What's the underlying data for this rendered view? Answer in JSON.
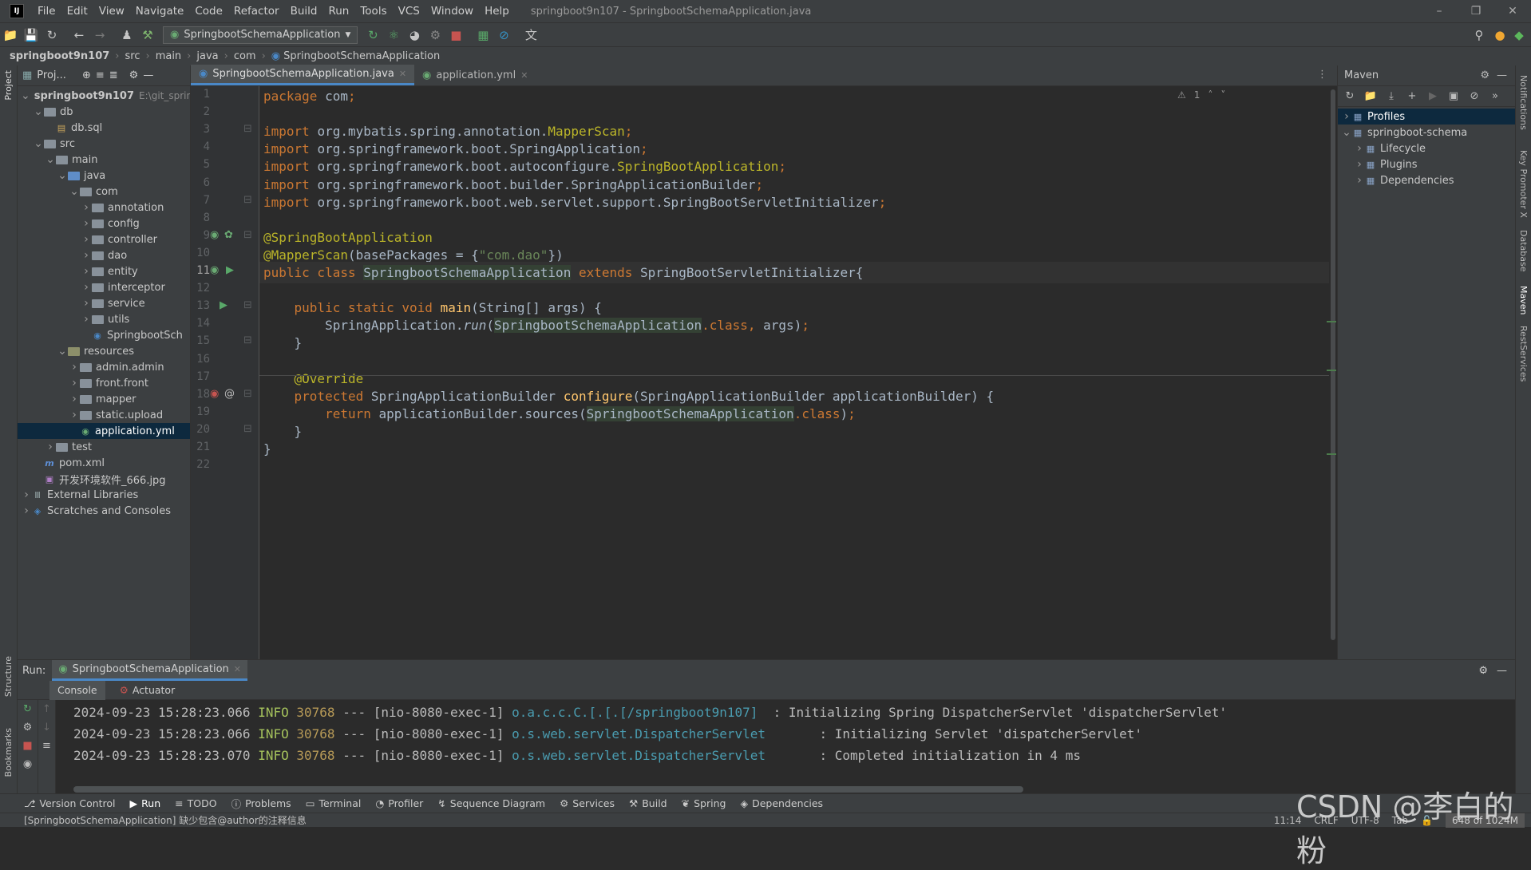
{
  "window": {
    "title": "springboot9n107 - SpringbootSchemaApplication.java"
  },
  "menu": [
    "File",
    "Edit",
    "View",
    "Navigate",
    "Code",
    "Refactor",
    "Build",
    "Run",
    "Tools",
    "VCS",
    "Window",
    "Help"
  ],
  "toolbar": {
    "run_config": "SpringbootSchemaApplication"
  },
  "breadcrumb": [
    "springboot9n107",
    "src",
    "main",
    "java",
    "com",
    "SpringbootSchemaApplication"
  ],
  "left_strip": {
    "project": "Project",
    "structure": "Structure",
    "bookmarks": "Bookmarks"
  },
  "project_panel": {
    "header": "Proj...",
    "items": [
      {
        "label": "springboot9n107",
        "extra": "E:\\git_sprin",
        "depth": 0,
        "kind": "module",
        "open": true
      },
      {
        "label": "db",
        "depth": 1,
        "kind": "folder",
        "open": true
      },
      {
        "label": "db.sql",
        "depth": 2,
        "kind": "sql"
      },
      {
        "label": "src",
        "depth": 1,
        "kind": "folder",
        "open": true
      },
      {
        "label": "main",
        "depth": 2,
        "kind": "folder",
        "open": true
      },
      {
        "label": "java",
        "depth": 3,
        "kind": "src",
        "open": true
      },
      {
        "label": "com",
        "depth": 4,
        "kind": "folder",
        "open": true
      },
      {
        "label": "annotation",
        "depth": 5,
        "kind": "folder",
        "open": false
      },
      {
        "label": "config",
        "depth": 5,
        "kind": "folder",
        "open": false
      },
      {
        "label": "controller",
        "depth": 5,
        "kind": "folder",
        "open": false
      },
      {
        "label": "dao",
        "depth": 5,
        "kind": "folder",
        "open": false
      },
      {
        "label": "entity",
        "depth": 5,
        "kind": "folder",
        "open": false
      },
      {
        "label": "interceptor",
        "depth": 5,
        "kind": "folder",
        "open": false
      },
      {
        "label": "service",
        "depth": 5,
        "kind": "folder",
        "open": false
      },
      {
        "label": "utils",
        "depth": 5,
        "kind": "folder",
        "open": false
      },
      {
        "label": "SpringbootSch",
        "depth": 5,
        "kind": "class"
      },
      {
        "label": "resources",
        "depth": 3,
        "kind": "res",
        "open": true
      },
      {
        "label": "admin.admin",
        "depth": 4,
        "kind": "folder",
        "open": false
      },
      {
        "label": "front.front",
        "depth": 4,
        "kind": "folder",
        "open": false
      },
      {
        "label": "mapper",
        "depth": 4,
        "kind": "folder",
        "open": false
      },
      {
        "label": "static.upload",
        "depth": 4,
        "kind": "folder",
        "open": false
      },
      {
        "label": "application.yml",
        "depth": 4,
        "kind": "yml",
        "selected": true
      },
      {
        "label": "test",
        "depth": 2,
        "kind": "folder",
        "open": false
      },
      {
        "label": "pom.xml",
        "depth": 1,
        "kind": "maven"
      },
      {
        "label": "开发环境软件_666.jpg",
        "depth": 1,
        "kind": "image"
      },
      {
        "label": "External Libraries",
        "depth": 0,
        "kind": "libs",
        "open": false
      },
      {
        "label": "Scratches and Consoles",
        "depth": 0,
        "kind": "scratch",
        "open": false
      }
    ]
  },
  "editor_tabs": [
    {
      "label": "SpringbootSchemaApplication.java",
      "active": true
    },
    {
      "label": "application.yml",
      "active": false
    }
  ],
  "inspection_count": "1",
  "code_lines": [
    [
      [
        "kw",
        "package "
      ],
      [
        "",
        "com"
      ],
      [
        "kw",
        ";"
      ]
    ],
    [],
    [
      [
        "kw",
        "import "
      ],
      [
        "",
        "org.mybatis.spring.annotation."
      ],
      [
        "an",
        "MapperScan"
      ],
      [
        "kw",
        ";"
      ]
    ],
    [
      [
        "kw",
        "import "
      ],
      [
        "",
        "org.springframework.boot.SpringApplication"
      ],
      [
        "kw",
        ";"
      ]
    ],
    [
      [
        "kw",
        "import "
      ],
      [
        "",
        "org.springframework.boot.autoconfigure."
      ],
      [
        "an",
        "SpringBootApplication"
      ],
      [
        "kw",
        ";"
      ]
    ],
    [
      [
        "kw",
        "import "
      ],
      [
        "",
        "org.springframework.boot.builder.SpringApplicationBuilder"
      ],
      [
        "kw",
        ";"
      ]
    ],
    [
      [
        "kw",
        "import "
      ],
      [
        "",
        "org.springframework.boot.web.servlet.support.SpringBootServletInitializer"
      ],
      [
        "kw",
        ";"
      ]
    ],
    [],
    [
      [
        "an",
        "@SpringBootApplication"
      ]
    ],
    [
      [
        "an",
        "@MapperScan"
      ],
      [
        "",
        "(basePackages = {"
      ],
      [
        "str",
        "\"com.dao\""
      ],
      [
        "",
        "})"
      ]
    ],
    [
      [
        "kw",
        "public class "
      ],
      [
        "ref",
        "SpringbootSchemaApplication"
      ],
      [
        "kw",
        " extends "
      ],
      [
        "",
        "SpringBootServletInitializer{"
      ]
    ],
    [],
    [
      [
        "",
        "    "
      ],
      [
        "kw",
        "public static void "
      ],
      [
        "fn",
        "main"
      ],
      [
        "",
        "(String[] args) {"
      ]
    ],
    [
      [
        "",
        "        SpringApplication."
      ],
      [
        "it",
        "run"
      ],
      [
        "",
        "("
      ],
      [
        "ref",
        "SpringbootSchemaApplication"
      ],
      [
        "kw",
        ".class, "
      ],
      [
        "",
        "args)"
      ],
      [
        "kw",
        ";"
      ]
    ],
    [
      [
        "",
        "    }"
      ]
    ],
    [],
    [
      [
        "",
        "    "
      ],
      [
        "an",
        "@Override"
      ]
    ],
    [
      [
        "",
        "    "
      ],
      [
        "kw",
        "protected "
      ],
      [
        "",
        "SpringApplicationBuilder "
      ],
      [
        "fn",
        "configure"
      ],
      [
        "",
        "(SpringApplicationBuilder applicationBuilder) {"
      ]
    ],
    [
      [
        "",
        "        "
      ],
      [
        "kw",
        "return "
      ],
      [
        "",
        "applicationBuilder.sources("
      ],
      [
        "ref",
        "SpringbootSchemaApplication"
      ],
      [
        "kw",
        ".class"
      ],
      [
        "",
        ")"
      ],
      [
        "kw",
        ";"
      ]
    ],
    [
      [
        "",
        "    }"
      ]
    ],
    [
      [
        "",
        "}"
      ]
    ],
    []
  ],
  "current_line": 11,
  "maven": {
    "title": "Maven",
    "items": [
      {
        "label": "Profiles",
        "depth": 0,
        "open": false,
        "selected": true
      },
      {
        "label": "springboot-schema",
        "depth": 0,
        "open": true
      },
      {
        "label": "Lifecycle",
        "depth": 1,
        "open": false
      },
      {
        "label": "Plugins",
        "depth": 1,
        "open": false
      },
      {
        "label": "Dependencies",
        "depth": 1,
        "open": false
      }
    ]
  },
  "right_strip": [
    "Notifications",
    "Key Promoter X",
    "Database",
    "Maven",
    "RestServices"
  ],
  "run_panel": {
    "label": "Run:",
    "config": "SpringbootSchemaApplication",
    "tabs": [
      "Console",
      "Actuator"
    ],
    "log": [
      {
        "ts": "2024-09-23 15:28:23.066",
        "level": "INFO",
        "pid": "30768",
        "thread": "--- [nio-8080-exec-1]",
        "logger": "o.a.c.c.C.[.[.[/springboot9n107]",
        "msg": "  : Initializing Spring DispatcherServlet 'dispatcherServlet'"
      },
      {
        "ts": "2024-09-23 15:28:23.066",
        "level": "INFO",
        "pid": "30768",
        "thread": "--- [nio-8080-exec-1]",
        "logger": "o.s.web.servlet.DispatcherServlet",
        "msg": "       : Initializing Servlet 'dispatcherServlet'"
      },
      {
        "ts": "2024-09-23 15:28:23.070",
        "level": "INFO",
        "pid": "30768",
        "thread": "--- [nio-8080-exec-1]",
        "logger": "o.s.web.servlet.DispatcherServlet",
        "msg": "       : Completed initialization in 4 ms"
      }
    ]
  },
  "bottom_tabs": [
    "Version Control",
    "Run",
    "TODO",
    "Problems",
    "Terminal",
    "Profiler",
    "Sequence Diagram",
    "Services",
    "Build",
    "Spring",
    "Dependencies"
  ],
  "status": {
    "message": "[SpringbootSchemaApplication] 缺少包含@author的注释信息",
    "position": "11:14",
    "line_sep": "CRLF",
    "encoding": "UTF-8",
    "indent": "Tab",
    "memory": "648 of 1024M"
  },
  "watermark": "CSDN @李白的粉",
  "colors": {
    "keyword": "#cc7832",
    "annotation": "#bbb529",
    "string": "#6a8759",
    "method": "#ffc66d",
    "selection": "#0d293e"
  }
}
